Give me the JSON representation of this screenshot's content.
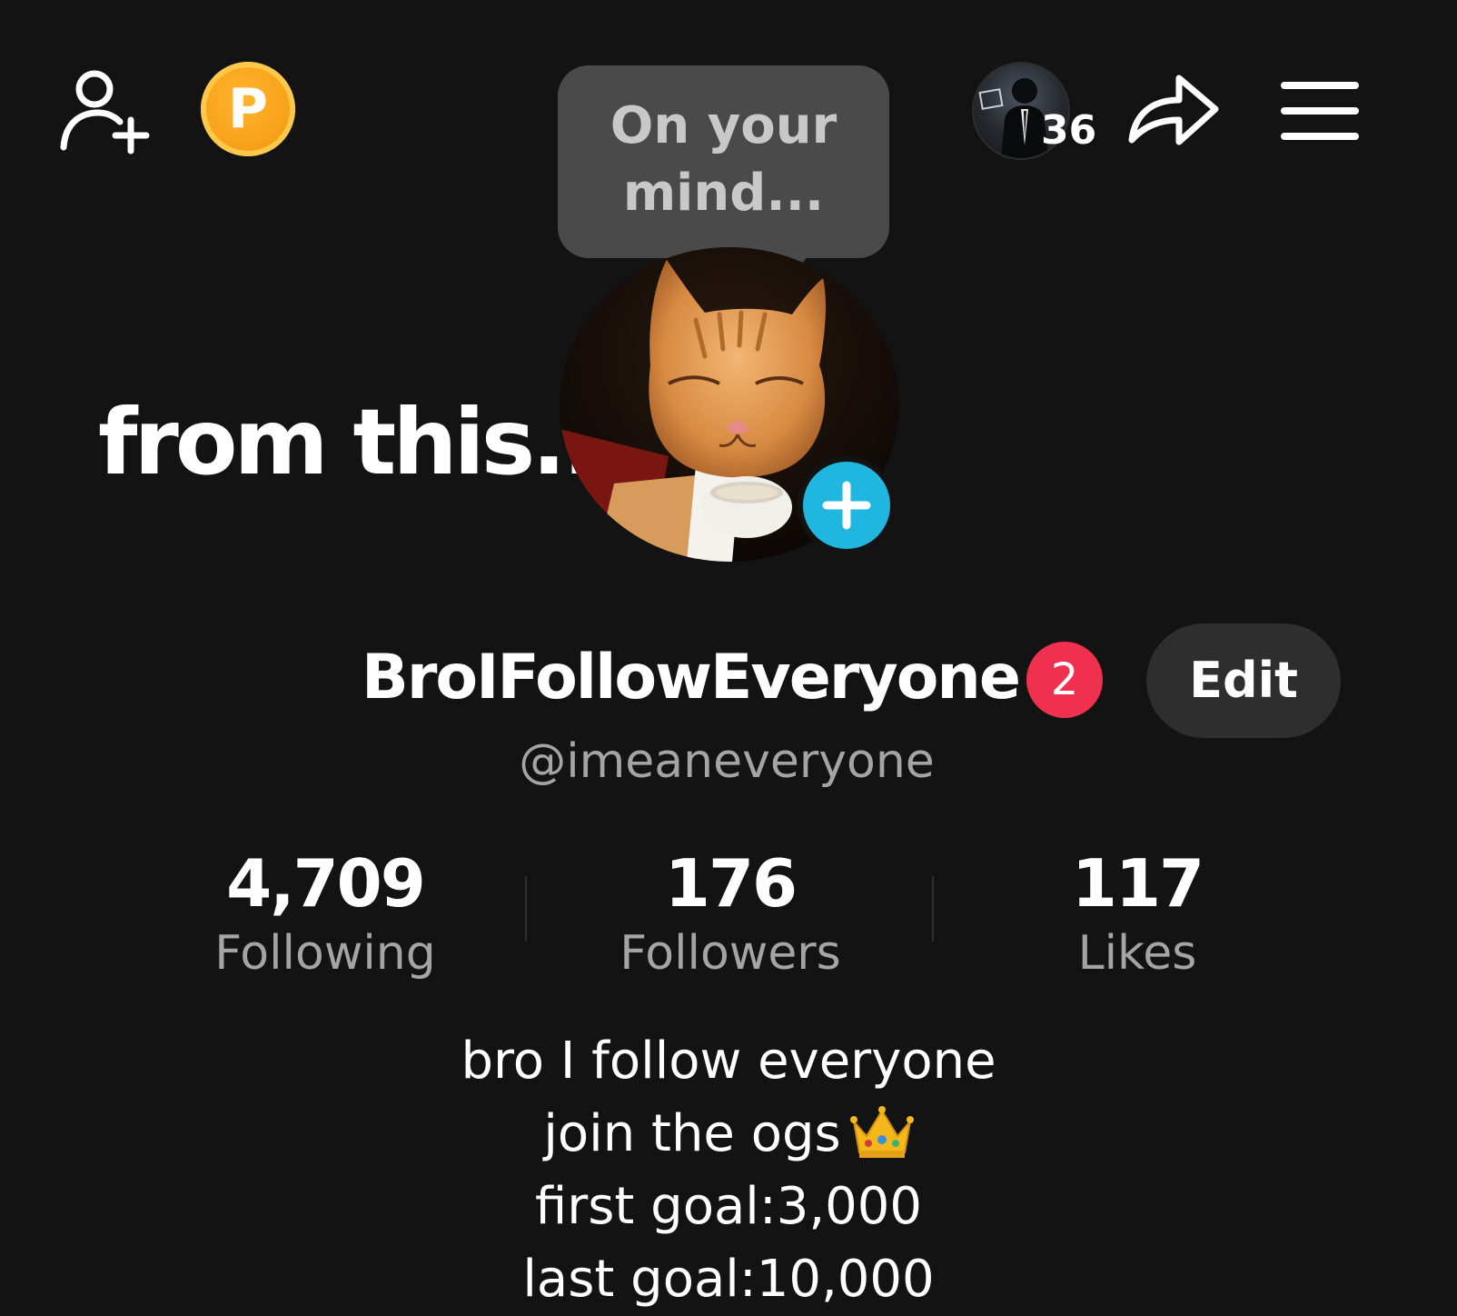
{
  "top_bar": {
    "coin_letter": "P",
    "mind_prompt": "On your mind...",
    "friend_count": "36"
  },
  "overlay": {
    "caption": "from this..."
  },
  "profile": {
    "display_name": "BroIFollowEveryone",
    "notification_count": "2",
    "edit_label": "Edit",
    "handle": "@imeaneveryone"
  },
  "stats": [
    {
      "value": "4,709",
      "label": "Following"
    },
    {
      "value": "176",
      "label": "Followers"
    },
    {
      "value": "117",
      "label": "Likes"
    }
  ],
  "bio": {
    "line1": "bro I follow everyone",
    "line2": "join the ogs",
    "line3": "first goal:3,000",
    "line4": "last goal:10,000"
  },
  "colors": {
    "background": "#131313",
    "accent_blue": "#1fb6e0",
    "badge_red": "#f0304f",
    "coin_orange": "#f7a21a"
  },
  "icons": [
    "add-user-icon",
    "coin-icon",
    "share-icon",
    "menu-icon",
    "plus-icon",
    "crown-icon"
  ]
}
